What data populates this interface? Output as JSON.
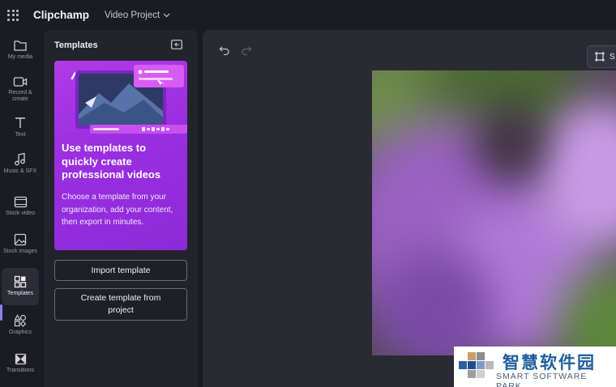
{
  "topbar": {
    "app_title": "Clipchamp",
    "project_name": "Video Project"
  },
  "rail": {
    "items": [
      {
        "label": "My media",
        "icon": "folder-icon"
      },
      {
        "label": "Record & create",
        "icon": "camera-icon"
      },
      {
        "label": "Text",
        "icon": "text-icon"
      },
      {
        "label": "Music & SFX",
        "icon": "music-icon"
      },
      {
        "label": "Stock video",
        "icon": "film-icon"
      },
      {
        "label": "Stock images",
        "icon": "image-icon"
      },
      {
        "label": "Templates",
        "icon": "templates-icon"
      },
      {
        "label": "Graphics",
        "icon": "shapes-icon"
      },
      {
        "label": "Transitions",
        "icon": "transitions-icon"
      }
    ],
    "active": "Templates"
  },
  "panel": {
    "title": "Templates",
    "promo": {
      "title": "Use templates to quickly create professional videos",
      "description": "Choose a template from your organization, add your content, then export in minutes."
    },
    "import_label": "Import template",
    "create_label": "Create template from project"
  },
  "editor": {
    "crop_label": "S"
  },
  "watermark": {
    "chinese": "智慧软件园",
    "english": "SMART SOFTWARE PARK"
  },
  "colors": {
    "accent": "#8a7cff",
    "promo_purple": "#a132e3",
    "background": "#1b1b22"
  }
}
